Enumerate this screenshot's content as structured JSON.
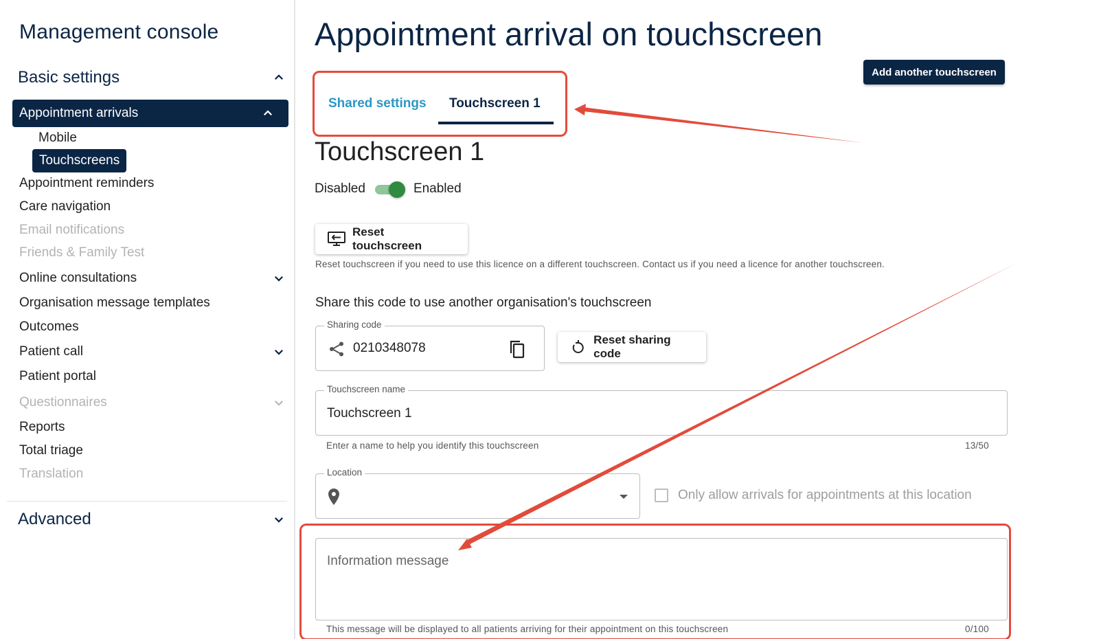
{
  "sidebar": {
    "title": "Management console",
    "basic_settings": "Basic settings",
    "active_item": "Appointment arrivals",
    "sub_items": [
      "Mobile",
      "Touchscreens"
    ],
    "items": [
      {
        "label": "Appointment reminders"
      },
      {
        "label": "Care navigation"
      },
      {
        "label": "Email notifications"
      },
      {
        "label": "Friends & Family Test"
      },
      {
        "label": "Online consultations"
      },
      {
        "label": "Organisation message templates"
      },
      {
        "label": "Outcomes"
      },
      {
        "label": "Patient call"
      },
      {
        "label": "Patient portal"
      },
      {
        "label": "Questionnaires"
      },
      {
        "label": "Reports"
      },
      {
        "label": "Total triage"
      },
      {
        "label": "Translation"
      }
    ],
    "advanced": "Advanced"
  },
  "main": {
    "page_title": "Appointment arrival on touchscreen",
    "add_button": "Add another touchscreen",
    "tabs": [
      {
        "label": "Shared settings"
      },
      {
        "label": "Touchscreen 1"
      }
    ],
    "section_title": "Touchscreen 1",
    "toggle": {
      "off_label": "Disabled",
      "on_label": "Enabled",
      "state": "on"
    },
    "reset_touchscreen": "Reset touchscreen",
    "reset_help": "Reset touchscreen if you need to use this licence on a different touchscreen. Contact us if you need a licence for another touchscreen.",
    "share_label": "Share this code to use another organisation's touchscreen",
    "sharing_code": {
      "label": "Sharing code",
      "value": "0210348078"
    },
    "reset_sharing_code": "Reset sharing code",
    "touchscreen_name": {
      "label": "Touchscreen name",
      "value": "Touchscreen 1",
      "help": "Enter a name to help you identify this touchscreen",
      "counter": "13/50"
    },
    "location": {
      "label": "Location",
      "value": ""
    },
    "only_allow": "Only allow arrivals for appointments at this location",
    "info_message": {
      "placeholder": "Information message",
      "help": "This message will be displayed to all patients arriving for their appointment on this touchscreen",
      "counter": "0/100"
    }
  },
  "colors": {
    "navy": "#0b2545",
    "accent_blue": "#2c97c4",
    "annotation_red": "#e24b3b",
    "toggle_green": "#2e8b3f"
  },
  "icons": [
    "chevron-up-icon",
    "chevron-down-icon",
    "monitor-reset-icon",
    "share-icon",
    "copy-icon",
    "refresh-icon",
    "location-pin-icon",
    "dropdown-caret-icon"
  ]
}
